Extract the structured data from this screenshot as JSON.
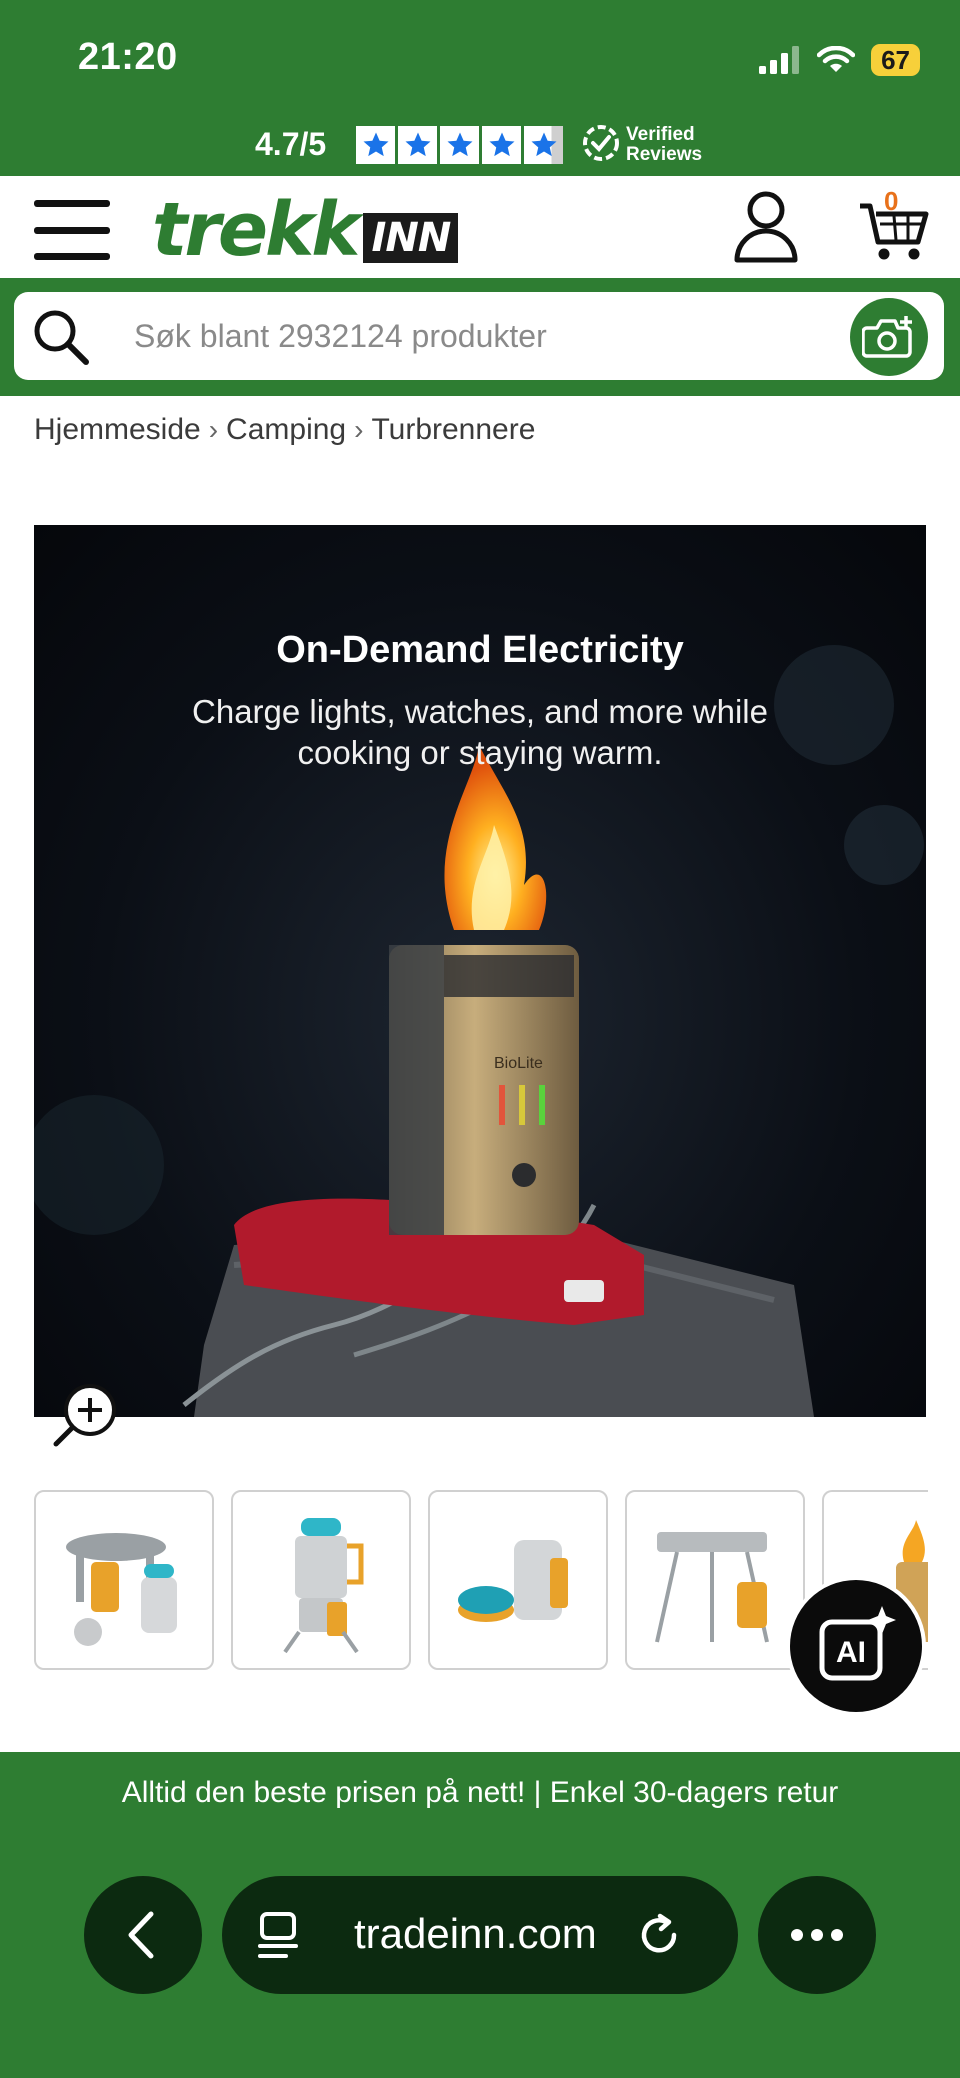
{
  "status_bar": {
    "time": "21:20",
    "battery": "67"
  },
  "rating": {
    "score": "4.7/5",
    "stars": 5,
    "verified_line1": "Verified",
    "verified_line2": "Reviews"
  },
  "header": {
    "logo_trekk": "trekk",
    "logo_inn": "INN",
    "cart_count": "0"
  },
  "search": {
    "placeholder": "Søk blant 2932124 produkter"
  },
  "breadcrumb": [
    "Hjemmeside",
    "Camping",
    "Turbrennere"
  ],
  "product_image": {
    "title": "On-Demand Electricity",
    "subtitle": "Charge lights, watches, and more while cooking or staying warm.",
    "brand_mark": "BioLite"
  },
  "thumbnails": [
    "stove-kit-thumbnail",
    "stove-kettle-thumbnail",
    "stove-accessories-thumbnail",
    "stove-grill-thumbnail",
    "stove-flame-thumbnail"
  ],
  "ai_button": {
    "label": "AI"
  },
  "promo": {
    "text": "Alltid den beste prisen på nett!  |  Enkel 30-dagers retur"
  },
  "browser": {
    "url": "tradeinn.com"
  },
  "colors": {
    "brand_green": "#2e7d32",
    "star_blue": "#1a73e8",
    "cart_orange": "#e8711a"
  }
}
